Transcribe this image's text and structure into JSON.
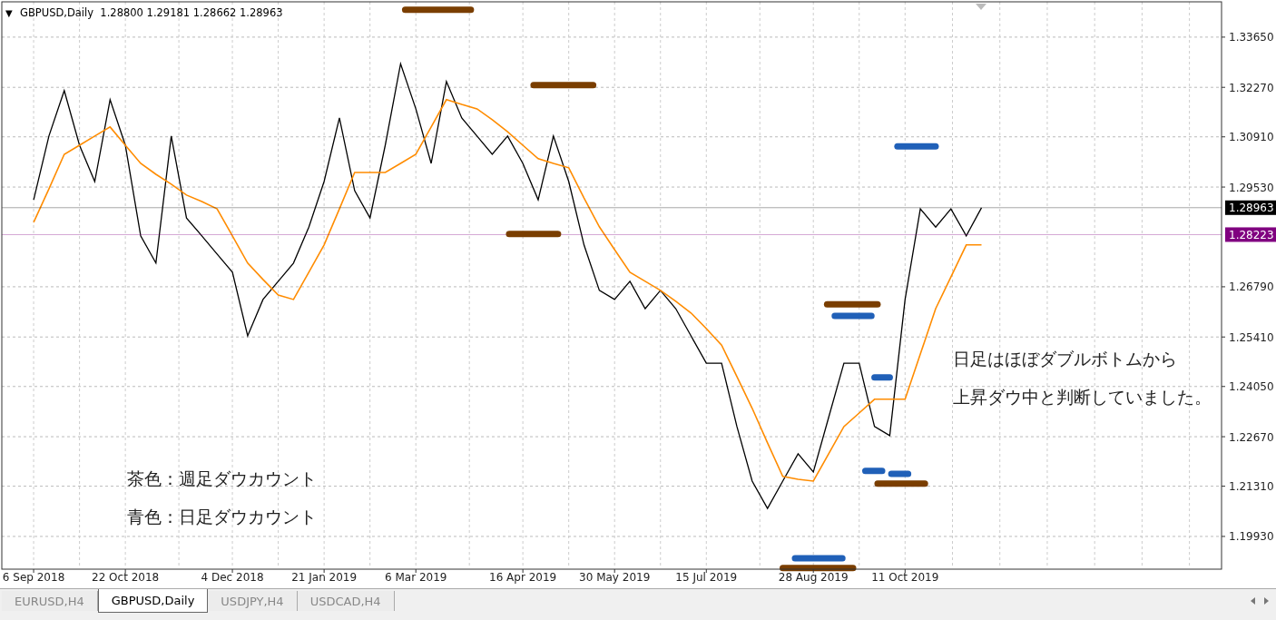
{
  "chart": {
    "header_icon": "▼",
    "header": "GBPUSD,Daily  1.28800 1.29181 1.28662 1.28963",
    "chart_data": {
      "type": "line",
      "grid": true,
      "ylim": [
        1.1908,
        1.3467
      ],
      "categories": [
        "6 Sep 2018",
        null,
        null,
        null,
        null,
        null,
        "22 Oct 2018",
        null,
        null,
        null,
        null,
        null,
        null,
        "4 Dec 2018",
        null,
        null,
        null,
        null,
        null,
        "21 Jan 2019",
        null,
        null,
        null,
        null,
        null,
        "6 Mar 2019",
        null,
        null,
        null,
        null,
        null,
        null,
        "16 Apr 2019",
        null,
        null,
        null,
        null,
        null,
        "30 May 2019",
        null,
        null,
        null,
        null,
        null,
        "15 Jul 2019",
        null,
        null,
        null,
        null,
        null,
        null,
        "28 Aug 2019",
        null,
        null,
        null,
        null,
        null,
        "11 Oct 2019",
        null,
        null,
        null,
        null,
        null
      ],
      "yticks": [
        {
          "value": 1.3365,
          "label": "1.33650"
        },
        {
          "value": 1.3227,
          "label": "1.32270"
        },
        {
          "value": 1.3091,
          "label": "1.30910"
        },
        {
          "value": 1.2953,
          "label": "1.29530"
        },
        {
          "value": 1.2679,
          "label": "1.26790"
        },
        {
          "value": 1.2541,
          "label": "1.25410"
        },
        {
          "value": 1.2405,
          "label": "1.24050"
        },
        {
          "value": 1.2267,
          "label": "1.22670"
        },
        {
          "value": 1.2131,
          "label": "1.21310"
        },
        {
          "value": 1.1993,
          "label": "1.19930"
        }
      ],
      "series": [
        {
          "color": "#000000",
          "values": [
            1.2918,
            1.3093,
            1.3218,
            1.3068,
            1.2968,
            1.3193,
            1.3068,
            1.2819,
            1.2744,
            1.3093,
            1.2868,
            1.2819,
            1.2769,
            1.2719,
            1.2544,
            1.2644,
            1.2694,
            1.2744,
            1.2843,
            1.2968,
            1.3143,
            1.2943,
            1.2868,
            1.3068,
            1.3292,
            1.3168,
            1.3018,
            1.3243,
            1.3143,
            1.3093,
            1.3043,
            1.3093,
            1.3018,
            1.2918,
            1.3093,
            1.2968,
            1.2794,
            1.2669,
            1.2644,
            1.2694,
            1.2619,
            1.2669,
            1.2619,
            1.2544,
            1.2469,
            1.2469,
            1.2295,
            1.2145,
            1.207,
            1.2145,
            1.222,
            1.217,
            1.232,
            1.2469,
            1.2469,
            1.2295,
            1.227,
            1.2644,
            1.2893,
            1.2843,
            1.2893,
            1.2819,
            1.2896
          ]
        },
        {
          "color": "#ff8c00",
          "values": [
            1.2856,
            1.2948,
            1.3043,
            1.3068,
            1.3093,
            1.3118,
            1.3068,
            1.3018,
            1.2988,
            1.2961,
            1.2931,
            1.2913,
            1.2893,
            1.2819,
            1.2744,
            1.2699,
            1.2656,
            1.2644,
            1.2719,
            1.2794,
            1.2893,
            1.2993,
            1.2993,
            1.2993,
            1.3018,
            1.3043,
            1.3118,
            1.3193,
            1.318,
            1.3168,
            1.3138,
            1.3105,
            1.3068,
            1.3031,
            1.3018,
            1.3006,
            1.2923,
            1.2844,
            1.2781,
            1.2719,
            1.2694,
            1.2669,
            1.2639,
            1.2607,
            1.2564,
            1.2519,
            1.2432,
            1.2345,
            1.225,
            1.2158,
            1.215,
            1.2145,
            1.222,
            1.2295,
            1.2332,
            1.237,
            1.237,
            1.237,
            1.2494,
            1.2619,
            1.2706,
            1.2794,
            1.2794
          ]
        }
      ],
      "ref_lines": [
        {
          "axis": "y",
          "value": 1.28963,
          "label": "1.28963",
          "color": "#000000"
        },
        {
          "axis": "y",
          "value": 1.28223,
          "label": "1.28223",
          "color": "#800080"
        }
      ]
    },
    "count_marks": [
      {
        "color": "#7a3e00"
      },
      {
        "color": "#7a3e00"
      },
      {
        "color": "#7a3e00"
      },
      {
        "color": "#7a3e00"
      },
      {
        "color": "#7a3e00"
      },
      {
        "color": "#7a3e00"
      },
      {
        "color": "#2060b8"
      },
      {
        "color": "#2060b8"
      },
      {
        "color": "#2060b8"
      },
      {
        "color": "#2060b8"
      },
      {
        "color": "#2060b8"
      },
      {
        "color": "#2060b8"
      }
    ],
    "legend": [
      "茶色：週足ダウカウント",
      "青色：日足ダウカウント"
    ],
    "comment": [
      "日足はほぼダブルボトムから",
      "上昇ダウ中と判断していました。"
    ]
  },
  "tabs": [
    {
      "label": "EURUSD,H4",
      "selected": false
    },
    {
      "label": "GBPUSD,Daily",
      "selected": true
    },
    {
      "label": "USDJPY,H4",
      "selected": false
    },
    {
      "label": "USDCAD,H4",
      "selected": false
    }
  ]
}
